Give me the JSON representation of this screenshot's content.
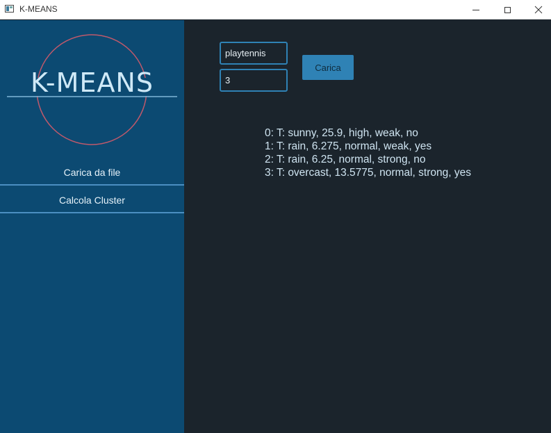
{
  "window": {
    "title": "K-MEANS"
  },
  "sidebar": {
    "logo_text": "K-MEANS",
    "items": [
      {
        "label": "Carica da file"
      },
      {
        "label": "Calcola Cluster"
      }
    ]
  },
  "main": {
    "dataset_input": {
      "value": "playtennis"
    },
    "k_input": {
      "value": "3"
    },
    "load_button": "Carica",
    "results": [
      "0: T: sunny, 25.9, high, weak, no",
      "1: T: rain, 6.275, normal, weak, yes",
      "2: T: rain, 6.25, normal, strong, no",
      "3: T: overcast, 13.5775, normal, strong, yes"
    ]
  },
  "colors": {
    "sidebar_bg": "#0c4a72",
    "main_bg": "#1b242c",
    "accent": "#2f82b5",
    "logo_circle": "#c0596b"
  }
}
